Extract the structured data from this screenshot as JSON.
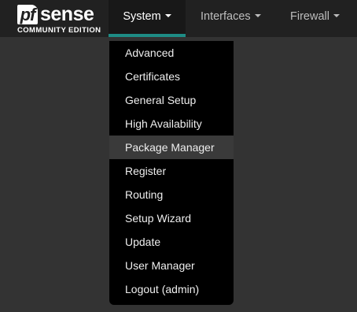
{
  "brand": {
    "logo_pf": "pf",
    "logo_sense": "sense",
    "edition": "COMMUNITY EDITION"
  },
  "nav": {
    "items": [
      {
        "label": "System",
        "active": true
      },
      {
        "label": "Interfaces",
        "active": false
      },
      {
        "label": "Firewall",
        "active": false
      }
    ]
  },
  "system_menu": {
    "items": [
      {
        "label": "Advanced"
      },
      {
        "label": "Certificates"
      },
      {
        "label": "General Setup"
      },
      {
        "label": "High Availability"
      },
      {
        "label": "Package Manager",
        "highlighted": true
      },
      {
        "label": "Register"
      },
      {
        "label": "Routing"
      },
      {
        "label": "Setup Wizard"
      },
      {
        "label": "Update"
      },
      {
        "label": "User Manager"
      },
      {
        "label": "Logout (admin)"
      }
    ]
  },
  "colors": {
    "accent": "#1e8c85",
    "navbar": "#212121",
    "background": "#333333",
    "dropdown": "#000000",
    "highlight": "#3a3a3a"
  },
  "icons": {
    "caret": "caret-down-icon"
  }
}
